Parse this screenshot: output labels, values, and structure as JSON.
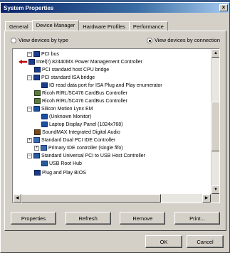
{
  "window": {
    "title": "System Properties",
    "close_glyph": "×"
  },
  "tabs": [
    {
      "label": "General"
    },
    {
      "label": "Device Manager"
    },
    {
      "label": "Hardware Profiles"
    },
    {
      "label": "Performance"
    }
  ],
  "view": {
    "by_type": "View devices by type",
    "by_connection": "View devices by connection",
    "selected": "by_connection"
  },
  "tree": [
    {
      "label": "PCI bus",
      "icon": "pc-icon",
      "expander": "−"
    },
    {
      "label": "Intel(r) 82440MX Power Management Controller",
      "icon": "pc-icon"
    },
    {
      "label": "PCI standard host CPU bridge",
      "icon": "pc-icon"
    },
    {
      "label": "PCI standard ISA bridge",
      "icon": "pc-icon",
      "expander": "−"
    },
    {
      "label": "IO read data port for ISA Plug and Play enumerator",
      "icon": "pc-icon"
    },
    {
      "label": "Ricoh R/RL/5C476 CardBus Controller",
      "icon": "card-icon"
    },
    {
      "label": "Ricoh R/RL/5C476 CardBus Controller",
      "icon": "card-icon"
    },
    {
      "label": "Silicon Motion Lynx EM",
      "icon": "monitor-icon",
      "expander": "−"
    },
    {
      "label": "(Unknown Monitor)",
      "icon": "monitor-icon"
    },
    {
      "label": "Laptop Display Panel (1024x768)",
      "icon": "monitor-icon"
    },
    {
      "label": "SoundMAX Integrated Digital Audio",
      "icon": "sound-icon"
    },
    {
      "label": "Standard Dual PCI IDE Controller",
      "icon": "controller-icon",
      "expander": "+"
    },
    {
      "label": "Primary IDE controller (single fifo)",
      "icon": "controller-icon",
      "expander": "+"
    },
    {
      "label": "Standard Universal PCI to USB Host Controller",
      "icon": "usb-icon",
      "expander": "−"
    },
    {
      "label": "USB Root Hub",
      "icon": "usb-icon"
    },
    {
      "label": "Plug and Play BIOS",
      "icon": "pc-icon"
    }
  ],
  "buttons": {
    "properties": "Properties",
    "refresh": "Refresh",
    "remove": "Remove",
    "print": "Print..."
  },
  "footer": {
    "ok": "OK",
    "cancel": "Cancel"
  }
}
